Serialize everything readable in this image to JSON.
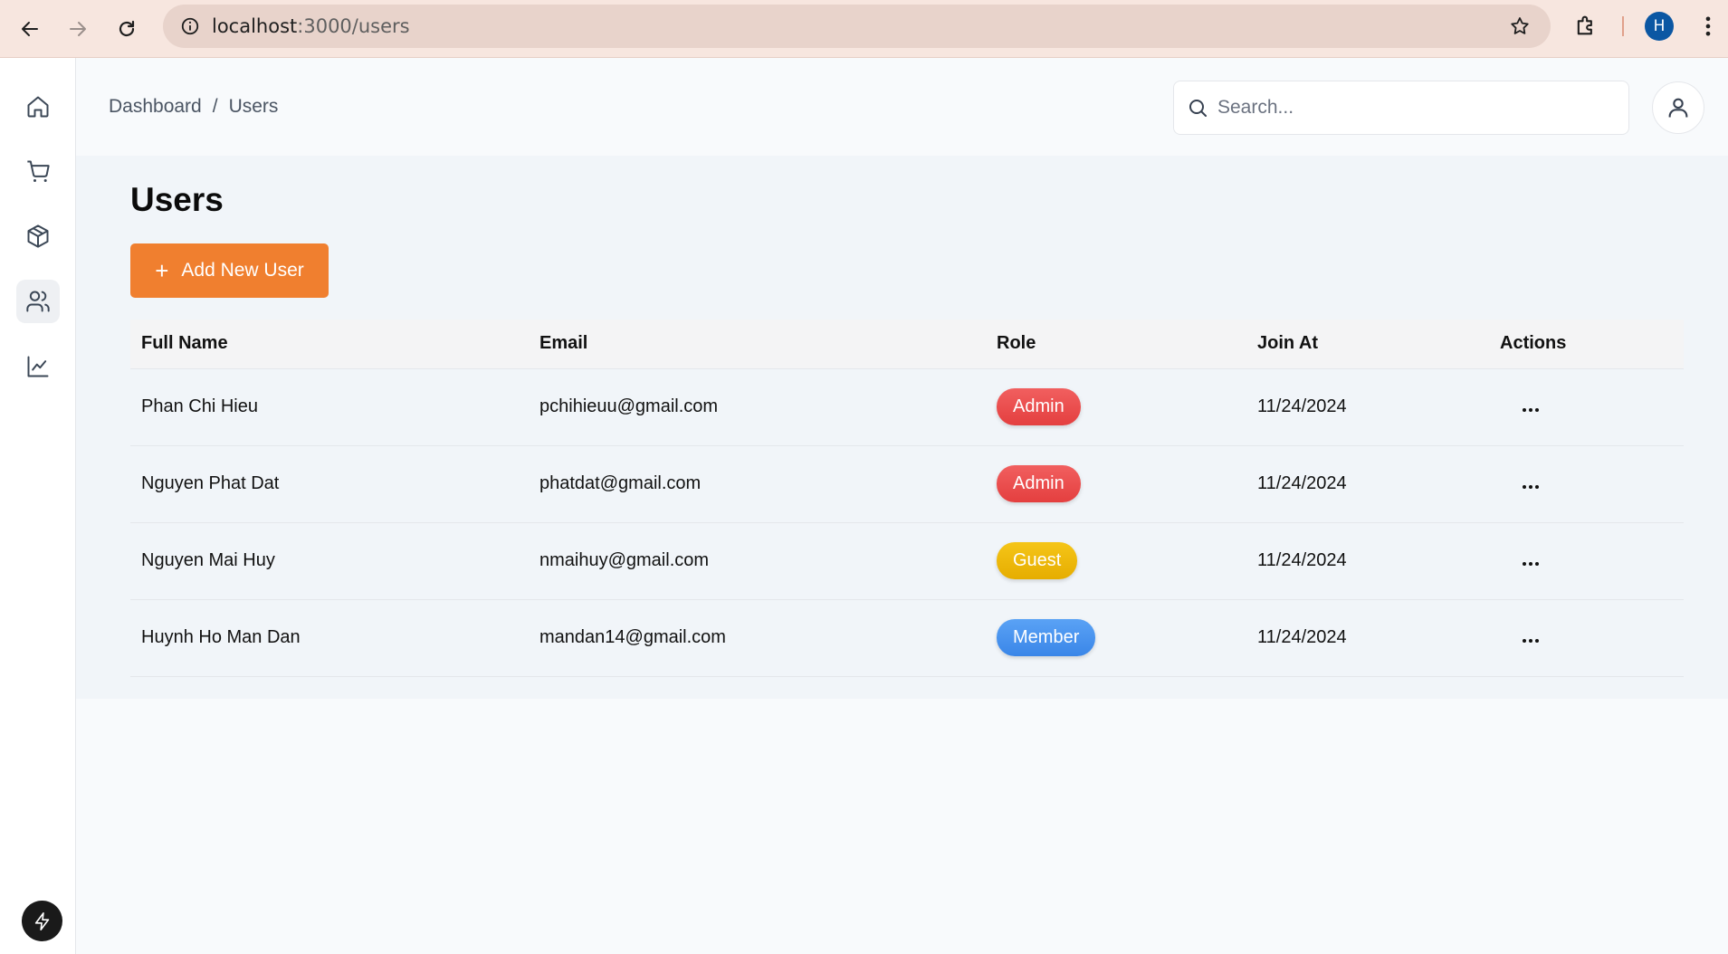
{
  "browser": {
    "url_host": "localhost",
    "url_path": ":3000/users",
    "profile_initial": "H"
  },
  "sidebar": {
    "items": [
      {
        "icon": "home-icon",
        "active": false
      },
      {
        "icon": "cart-icon",
        "active": false
      },
      {
        "icon": "package-icon",
        "active": false
      },
      {
        "icon": "users-icon",
        "active": true
      },
      {
        "icon": "chart-line-icon",
        "active": false
      }
    ]
  },
  "header": {
    "breadcrumb": [
      "Dashboard",
      "/",
      "Users"
    ],
    "search_placeholder": "Search..."
  },
  "main": {
    "title": "Users",
    "add_button_label": "Add New User",
    "table": {
      "columns": [
        "Full Name",
        "Email",
        "Role",
        "Join At",
        "Actions"
      ],
      "rows": [
        {
          "name": "Phan Chi Hieu",
          "email": "pchihieuu@gmail.com",
          "role": "Admin",
          "joined": "11/24/2024"
        },
        {
          "name": "Nguyen Phat Dat",
          "email": "phatdat@gmail.com",
          "role": "Admin",
          "joined": "11/24/2024"
        },
        {
          "name": "Nguyen Mai Huy",
          "email": "nmaihuy@gmail.com",
          "role": "Guest",
          "joined": "11/24/2024"
        },
        {
          "name": "Huynh Ho Man Dan",
          "email": "mandan14@gmail.com",
          "role": "Member",
          "joined": "11/24/2024"
        }
      ]
    }
  },
  "colors": {
    "accent": "#f07f2f",
    "admin": "#e84848",
    "guest": "#f0b90b",
    "member": "#4a94f0"
  }
}
